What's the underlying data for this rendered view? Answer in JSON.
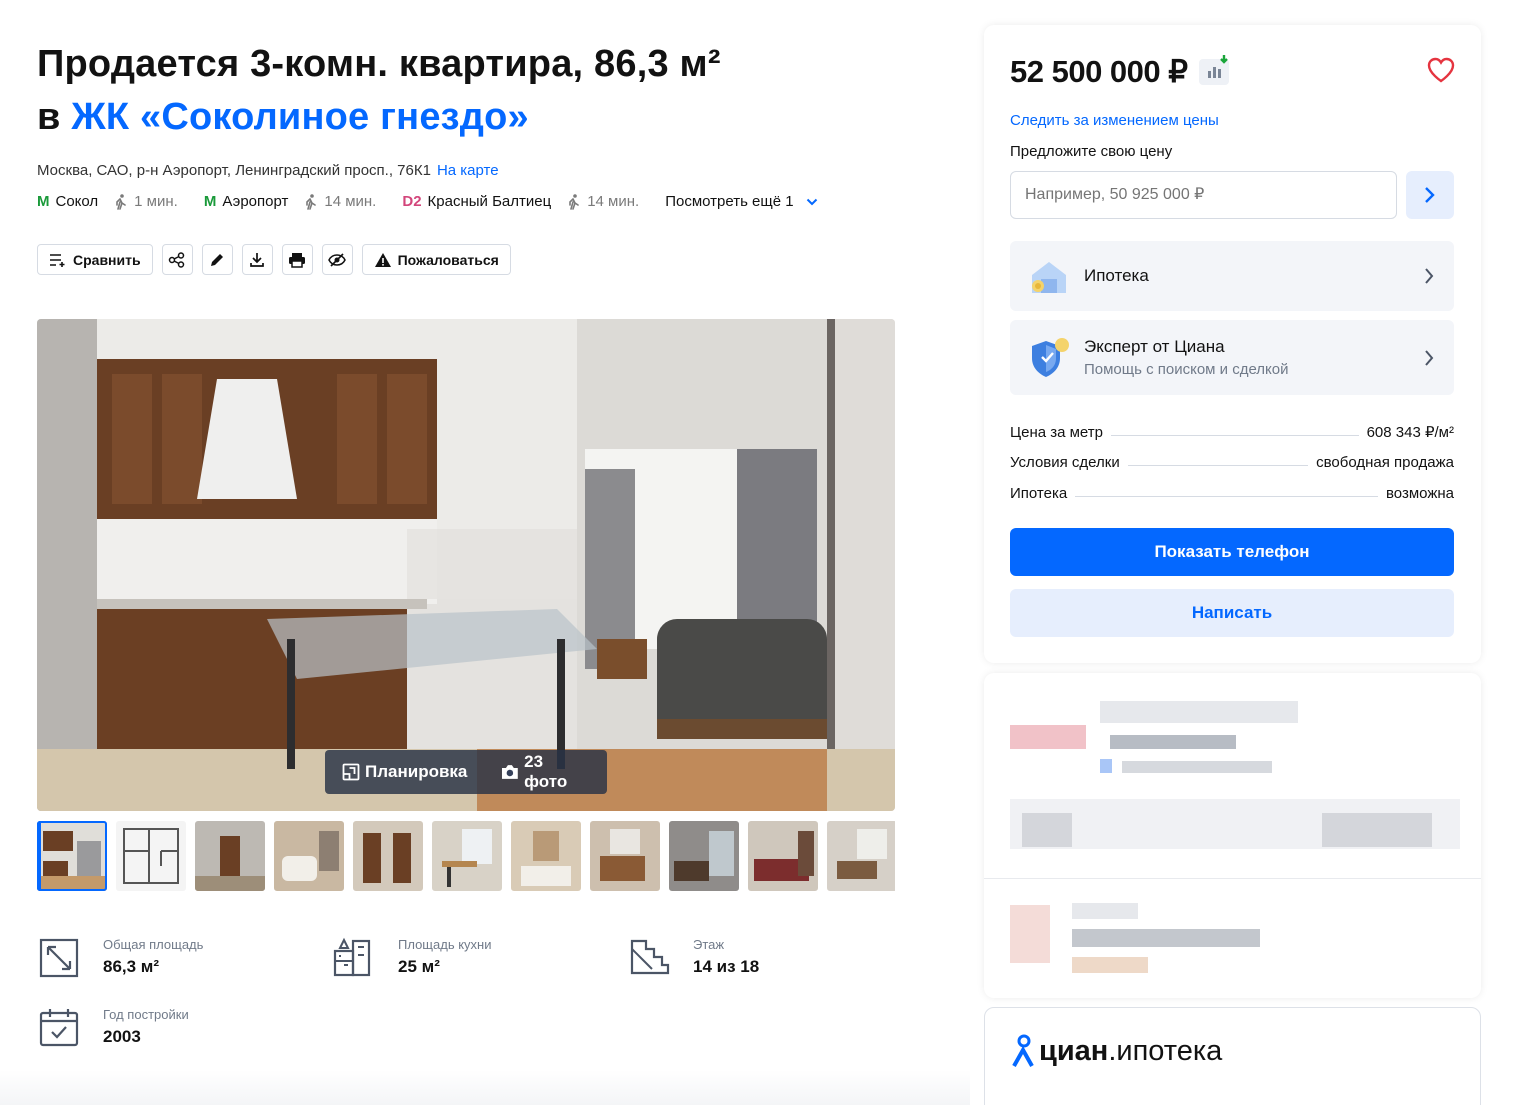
{
  "title": {
    "line1": "Продается 3-комн. квартира, 86,3 м²",
    "line2_prefix": "в ",
    "complex_link": "ЖК «Соколиное гнездо»"
  },
  "address": {
    "text": "Москва, САО, р-н Аэропорт, Ленинградский просп., 76К1",
    "map_link": "На карте"
  },
  "metro": [
    {
      "icon": "metro-m-icon",
      "name": "Сокол",
      "time": "1 мин."
    },
    {
      "icon": "metro-m-icon",
      "name": "Аэропорт",
      "time": "14 мин."
    },
    {
      "icon": "d2-icon",
      "badge": "D2",
      "name": "Красный Балтиец",
      "time": "14 мин."
    }
  ],
  "metro_more": "Посмотреть ещё 1",
  "actions": {
    "compare": "Сравнить",
    "complain": "Пожаловаться"
  },
  "gallery": {
    "layout_btn": "Планировка",
    "photos_btn": "23 фото",
    "watermark": "etagi"
  },
  "facts": [
    {
      "icon": "area-icon",
      "label": "Общая площадь",
      "value": "86,3 м²"
    },
    {
      "icon": "kitchen-icon",
      "label": "Площадь кухни",
      "value": "25 м²"
    },
    {
      "icon": "stairs-icon",
      "label": "Этаж",
      "value": "14 из 18"
    },
    {
      "icon": "calendar-icon",
      "label": "Год постройки",
      "value": "2003"
    }
  ],
  "sidebar": {
    "price": "52 500 000 ₽",
    "follow_price": "Следить за изменением цены",
    "offer_label": "Предложите свою цену",
    "offer_placeholder": "Например, 50 925 000 ₽",
    "mortgage": {
      "title": "Ипотека"
    },
    "expert": {
      "title": "Эксперт от Циана",
      "subtitle": "Помощь с поиском и сделкой"
    },
    "details": [
      {
        "key": "Цена за метр",
        "value": "608 343 ₽/м²"
      },
      {
        "key": "Условия сделки",
        "value": "свободная продажа"
      },
      {
        "key": "Ипотека",
        "value": "возможна"
      }
    ],
    "show_phone": "Показать телефон",
    "write": "Написать"
  },
  "cian_promo": {
    "brand": "циан",
    "product": ".ипотека"
  },
  "colors": {
    "accent": "#0468ff",
    "accent_light": "#e6eefd",
    "metro_green": "#1a9a3a",
    "d2_pink": "#d3467b",
    "heart": "#e5343f"
  }
}
